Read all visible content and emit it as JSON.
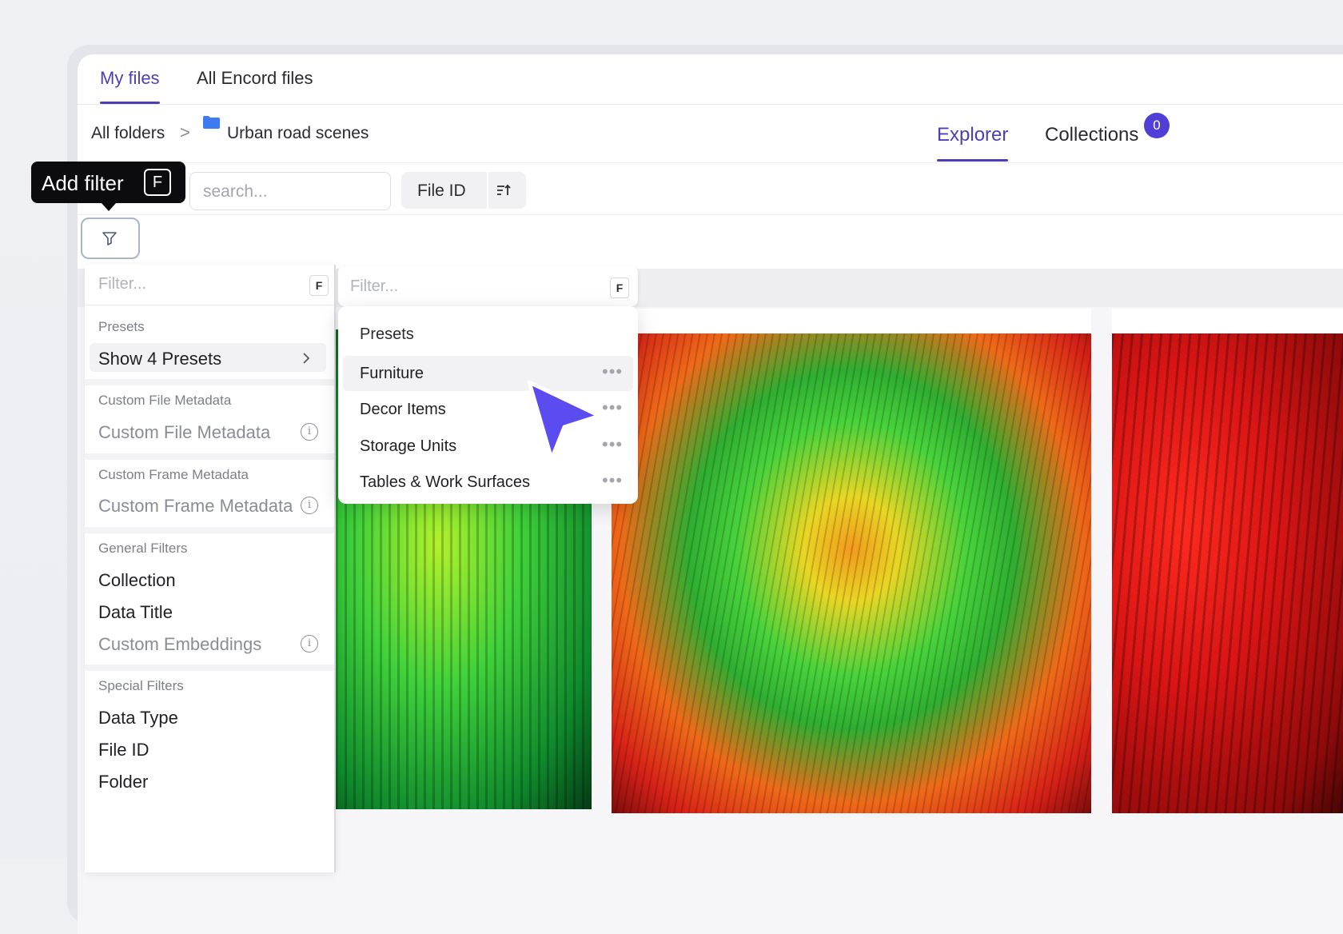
{
  "top_tabs": [
    {
      "label": "My files",
      "active": true
    },
    {
      "label": "All Encord files",
      "active": false
    }
  ],
  "breadcrumb": {
    "root": "All folders",
    "separator": ">",
    "current": "Urban road scenes",
    "folder_icon_color": "#3d7cf0"
  },
  "view_tabs": {
    "explorer": "Explorer",
    "collections": "Collections",
    "collections_count": "0"
  },
  "search": {
    "placeholder": "search..."
  },
  "sort": {
    "label": "File ID",
    "icon": "sort-ascending-icon"
  },
  "tooltip": {
    "text": "Add filter",
    "shortcut": "F"
  },
  "filter_panel": {
    "placeholder": "Filter...",
    "shortcut": "F",
    "sections": {
      "presets": {
        "title": "Presets",
        "item": "Show 4 Presets"
      },
      "custom_file": {
        "title": "Custom File Metadata",
        "item": "Custom File Metadata"
      },
      "custom_frame": {
        "title": "Custom Frame Metadata",
        "item": "Custom Frame Metadata"
      },
      "general": {
        "title": "General Filters",
        "items": [
          "Collection",
          "Data Title",
          "Custom Embeddings"
        ]
      },
      "special": {
        "title": "Special Filters",
        "items": [
          "Data Type",
          "File ID",
          "Folder"
        ]
      }
    }
  },
  "presets_panel": {
    "placeholder": "Filter...",
    "shortcut": "F",
    "title": "Presets",
    "items": [
      "Furniture",
      "Decor Items",
      "Storage Units",
      "Tables & Work Surfaces"
    ],
    "more_icon": "ellipsis-icon"
  },
  "colors": {
    "accent": "#4c3fb4",
    "badge": "#4f3fd6",
    "cursor": "#5b4cf0"
  }
}
